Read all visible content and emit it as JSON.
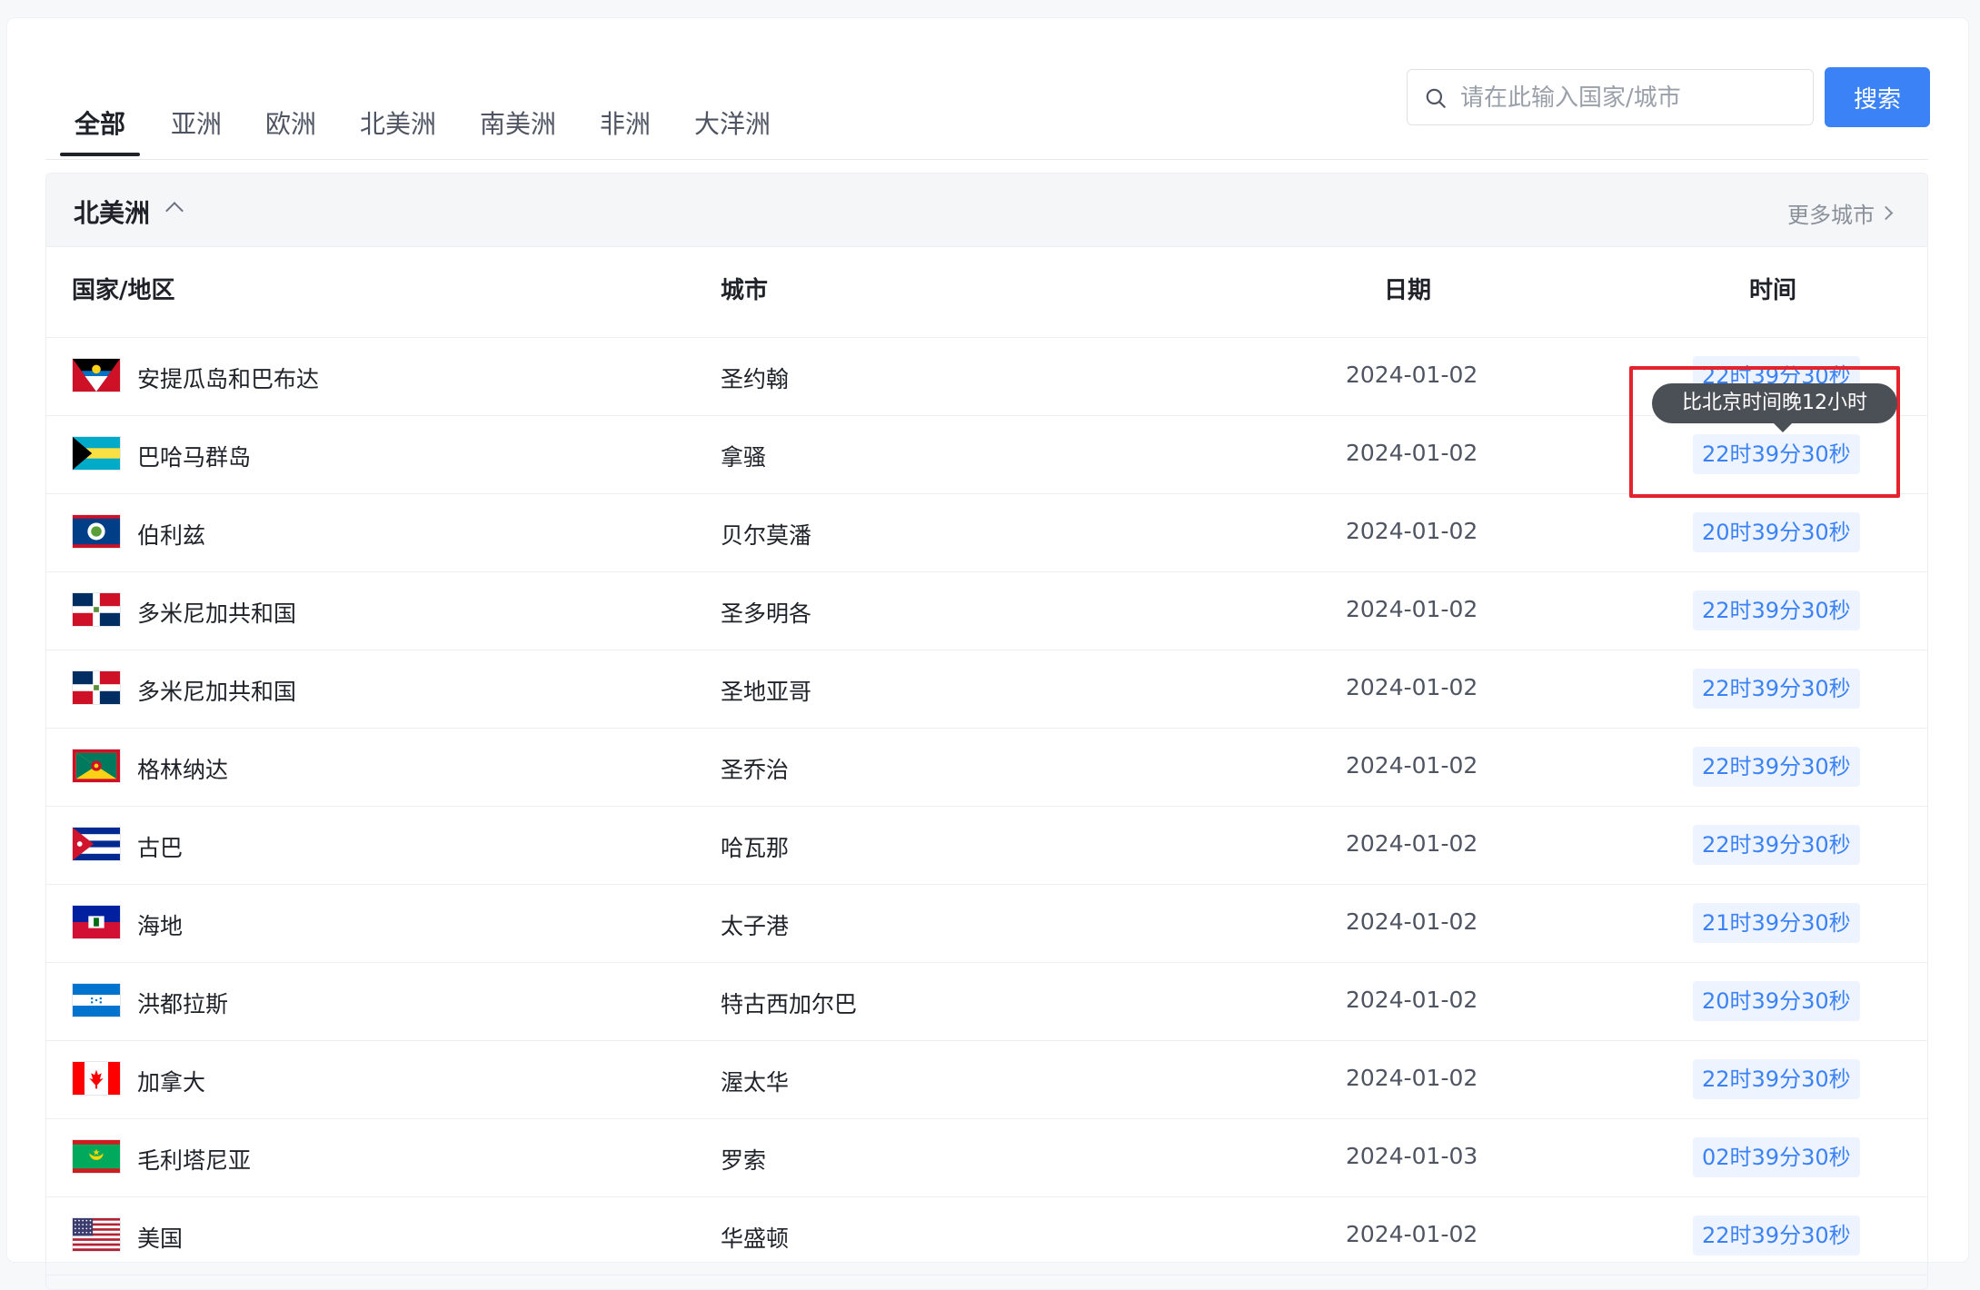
{
  "tabs": [
    "全部",
    "亚洲",
    "欧洲",
    "北美洲",
    "南美洲",
    "非洲",
    "大洋洲"
  ],
  "search": {
    "placeholder": "请在此输入国家/城市",
    "button": "搜索"
  },
  "panel": {
    "title": "北美洲",
    "more": "更多城市"
  },
  "columns": {
    "country": "国家/地区",
    "city": "城市",
    "date": "日期",
    "time": "时间"
  },
  "tooltip": "比北京时间晚12小时",
  "rows": [
    {
      "country": "安提瓜岛和巴布达",
      "city": "圣约翰",
      "date": "2024-01-02",
      "time": "22时39分30秒",
      "flag": "antigua"
    },
    {
      "country": "巴哈马群岛",
      "city": "拿骚",
      "date": "2024-01-02",
      "time": "22时39分30秒",
      "flag": "bahamas"
    },
    {
      "country": "伯利兹",
      "city": "贝尔莫潘",
      "date": "2024-01-02",
      "time": "20时39分30秒",
      "flag": "belize"
    },
    {
      "country": "多米尼加共和国",
      "city": "圣多明各",
      "date": "2024-01-02",
      "time": "22时39分30秒",
      "flag": "dominican"
    },
    {
      "country": "多米尼加共和国",
      "city": "圣地亚哥",
      "date": "2024-01-02",
      "time": "22时39分30秒",
      "flag": "dominican"
    },
    {
      "country": "格林纳达",
      "city": "圣乔治",
      "date": "2024-01-02",
      "time": "22时39分30秒",
      "flag": "grenada"
    },
    {
      "country": "古巴",
      "city": "哈瓦那",
      "date": "2024-01-02",
      "time": "22时39分30秒",
      "flag": "cuba"
    },
    {
      "country": "海地",
      "city": "太子港",
      "date": "2024-01-02",
      "time": "21时39分30秒",
      "flag": "haiti"
    },
    {
      "country": "洪都拉斯",
      "city": "特古西加尔巴",
      "date": "2024-01-02",
      "time": "20时39分30秒",
      "flag": "honduras"
    },
    {
      "country": "加拿大",
      "city": "渥太华",
      "date": "2024-01-02",
      "time": "22时39分30秒",
      "flag": "canada"
    },
    {
      "country": "毛利塔尼亚",
      "city": "罗索",
      "date": "2024-01-03",
      "time": "02时39分30秒",
      "flag": "mauritania"
    },
    {
      "country": "美国",
      "city": "华盛顿",
      "date": "2024-01-02",
      "time": "22时39分30秒",
      "flag": "usa"
    }
  ]
}
